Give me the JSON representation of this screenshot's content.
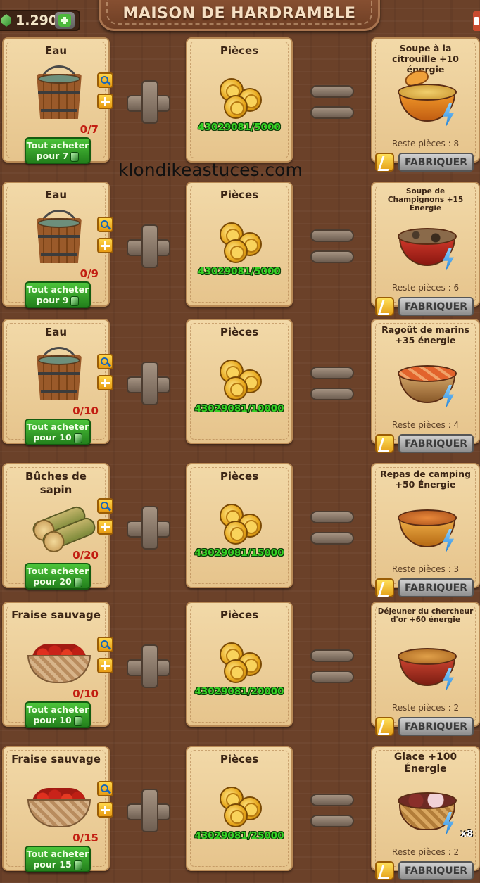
{
  "header": {
    "title": "MAISON DE HARDRAMBLE",
    "balance": "1.290"
  },
  "watermark": "klondikeastuces.com",
  "labels": {
    "coins": "Pièces",
    "fabricate": "FABRIQUER"
  },
  "recipes": [
    {
      "ingredient": "Eau",
      "ingredient_icon": "water-bucket",
      "count": "0/7",
      "buy_line1": "Tout acheter",
      "buy_line2": "pour 7",
      "coins": "43029081/5000",
      "result": "Soupe à la citrouille +10 énergie",
      "result_icon": "pumpkin-soup",
      "remaining": "Reste pièces : 8"
    },
    {
      "ingredient": "Eau",
      "ingredient_icon": "water-bucket",
      "count": "0/9",
      "buy_line1": "Tout acheter",
      "buy_line2": "pour 9",
      "coins": "43029081/5000",
      "result": "Soupe de Champignons +15 Énergie",
      "result_icon": "mushroom-soup",
      "remaining": "Reste pièces : 6"
    },
    {
      "ingredient": "Eau",
      "ingredient_icon": "water-bucket",
      "count": "0/10",
      "buy_line1": "Tout acheter",
      "buy_line2": "pour 10",
      "coins": "43029081/10000",
      "result": "Ragoût de marins +35 énergie",
      "result_icon": "sailor-stew",
      "remaining": "Reste pièces : 4"
    },
    {
      "ingredient": "Bûches de sapin",
      "ingredient_icon": "fir-logs",
      "count": "0/20",
      "buy_line1": "Tout acheter",
      "buy_line2": "pour 20",
      "coins": "43029081/15000",
      "result": "Repas de camping +50 Énergie",
      "result_icon": "camping-meal",
      "remaining": "Reste pièces : 3"
    },
    {
      "ingredient": "Fraise sauvage",
      "ingredient_icon": "strawberry-basket",
      "count": "0/10",
      "buy_line1": "Tout acheter",
      "buy_line2": "pour 10",
      "coins": "43029081/20000",
      "result": "Déjeuner du chercheur d'or +60 énergie",
      "result_icon": "gold-seeker-lunch",
      "remaining": "Reste pièces : 2"
    },
    {
      "ingredient": "Fraise sauvage",
      "ingredient_icon": "strawberry-basket",
      "count": "0/15",
      "buy_line1": "Tout acheter",
      "buy_line2": "pour 15",
      "coins": "43029081/25000",
      "result": "Glace +100 Énergie",
      "result_icon": "ice-cream",
      "result_multiplier": "x8",
      "remaining": "Reste pièces : 2"
    }
  ],
  "colors": {
    "background": "#6b4129",
    "card": "#ecd09a",
    "buy_button": "#37a42b",
    "coin_text": "#36d225",
    "missing_count": "#c21e12",
    "fabricate_button": "#a8a8a8"
  }
}
